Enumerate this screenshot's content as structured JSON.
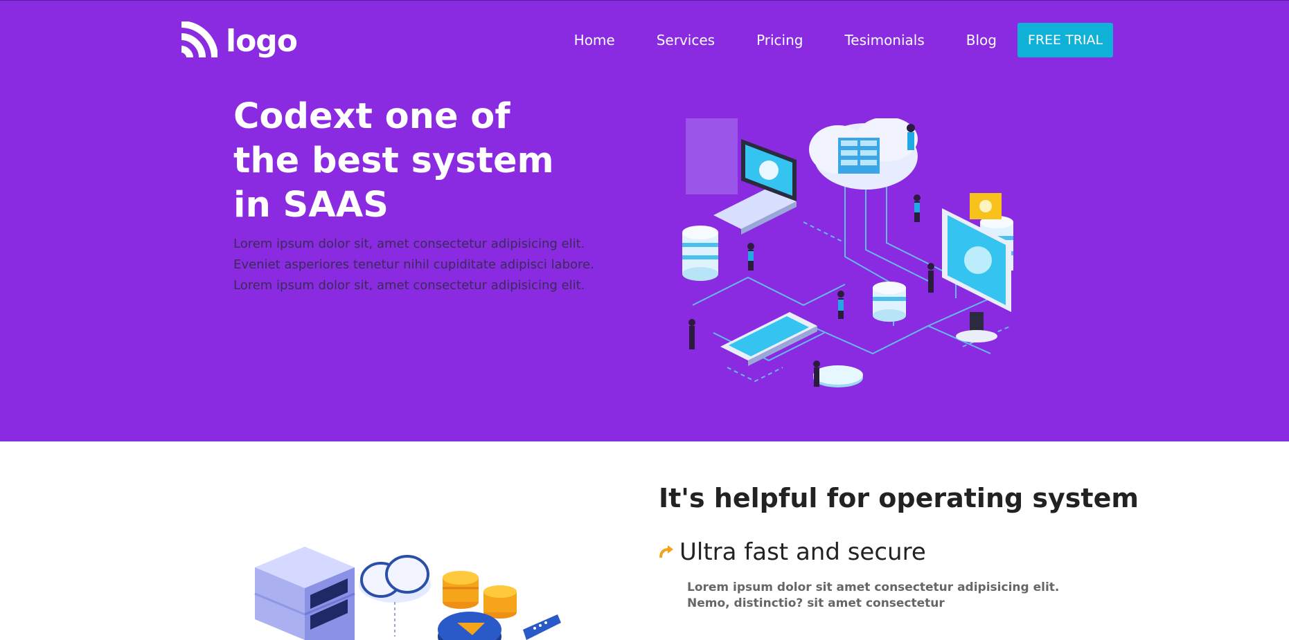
{
  "brand": {
    "logo_text": "logo",
    "icon": "wifi-arc-icon"
  },
  "nav": {
    "items": [
      "Home",
      "Services",
      "Pricing",
      "Tesimonials",
      "Blog"
    ],
    "cta": "FREE TRIAL"
  },
  "hero": {
    "title": "Codext one of\nthe best system\nin SAAS",
    "description": "Lorem ipsum dolor sit, amet consectetur adipisicing elit. Eveniet asperiores tenetur nihil cupiditate adipisci labore. Lorem ipsum dolor sit, amet consectetur adipisicing elit.",
    "illustration": "isometric-cloud-network-illustration"
  },
  "features": {
    "title": "It's helpful for operating system",
    "items": [
      {
        "icon": "curved-arrow-icon",
        "title": "Ultra fast and secure",
        "description": "Lorem ipsum dolor sit amet consectetur adipisicing elit. Nemo, distinctio? sit amet consectetur"
      }
    ],
    "illustration": "isometric-server-cloud-illustration"
  },
  "colors": {
    "hero_bg": "#8a2be2",
    "cta_bg": "#0fb2d6",
    "accent": "#f5a21b"
  }
}
